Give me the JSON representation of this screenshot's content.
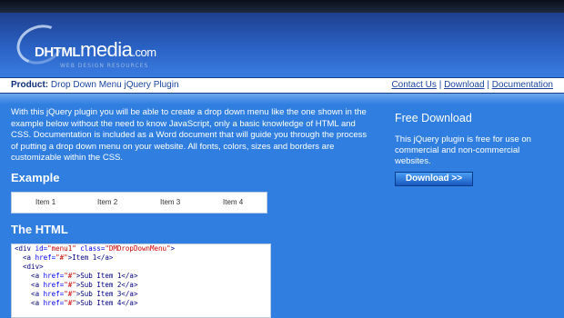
{
  "header": {
    "logo_prefix": "DHTML",
    "logo_name": "media",
    "logo_suffix": ".com",
    "tagline": "WEB DESIGN RESOURCES"
  },
  "infobar": {
    "product_label": "Product:",
    "product_name": "Drop Down Menu jQuery Plugin",
    "links": [
      "Contact Us",
      "Download",
      "Documentation"
    ],
    "separator": "|"
  },
  "main": {
    "intro": "With this jQuery plugin you will be able to create a drop down menu like the one shown in the example below without the need to know JavaScript, only a basic knowledge of HTML and CSS. Documentation is included as a Word document that will guide you through the process of putting a drop down menu on your website. All fonts, colors, sizes and borders are customizable within the CSS.",
    "example_heading": "Example",
    "menu_items": [
      "Item 1",
      "Item 2",
      "Item 3",
      "Item 4"
    ],
    "html_heading": "The HTML",
    "code": {
      "l1_open": "<div ",
      "l1_id_attr": "id=",
      "l1_id_val": "\"menu1\"",
      "l1_class_attr": " class=",
      "l1_class_val": "\"DMDropDownMenu\"",
      "l1_close": ">",
      "l2_open": "  <a ",
      "href_attr": "href=",
      "href_val": "\"#\"",
      "l2_rest": ">Item 1</a>",
      "l3": "  <div>",
      "sub_rest_1": ">Sub Item 1</a>",
      "sub_rest_2": ">Sub Item 2</a>",
      "sub_rest_3": ">Sub Item 3</a>",
      "sub_rest_4": ">Sub Item 4</a>",
      "sub_indent": "    <a "
    }
  },
  "sidebar": {
    "title": "Free Download",
    "text": "This jQuery plugin is free for use on commercial and non-commercial websites.",
    "download_label": "Download >>"
  }
}
